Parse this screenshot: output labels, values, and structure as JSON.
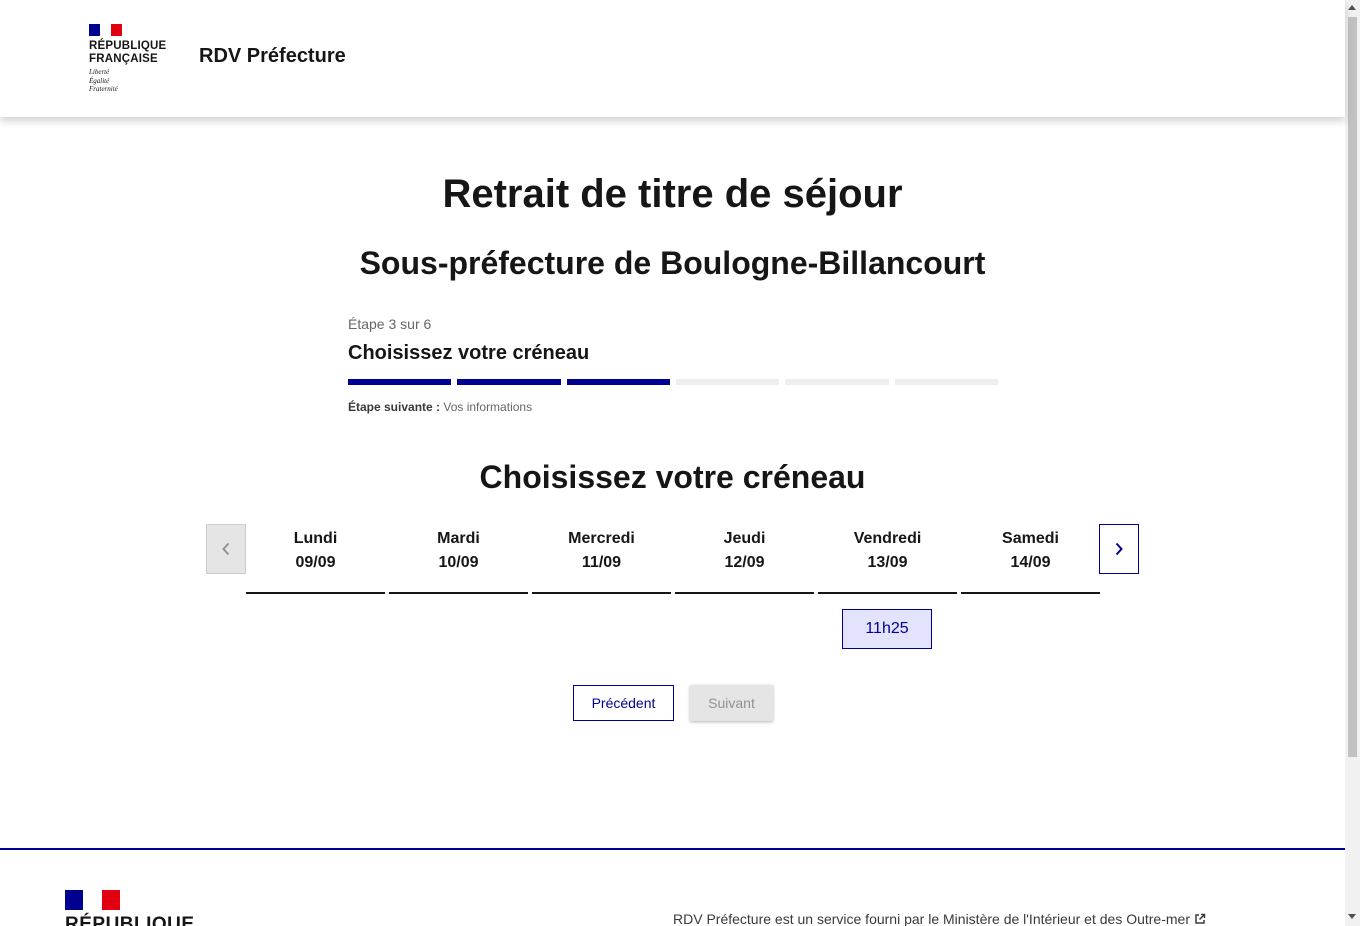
{
  "header": {
    "republique_line1": "RÉPUBLIQUE",
    "republique_line2": "FRANÇAISE",
    "devise_1": "Liberté",
    "devise_2": "Égalité",
    "devise_3": "Fraternité",
    "service_title": "RDV Préfecture"
  },
  "page": {
    "title": "Retrait de titre de séjour",
    "subtitle": "Sous-préfecture de Boulogne-Billancourt"
  },
  "stepper": {
    "state": "Étape 3 sur 6",
    "title": "Choisissez votre créneau",
    "current_step": 3,
    "total_steps": 6,
    "next_label": "Étape suivante :",
    "next_value": " Vos informations"
  },
  "calendar": {
    "title": "Choisissez votre créneau",
    "days": [
      {
        "name": "Lundi",
        "date": "09/09"
      },
      {
        "name": "Mardi",
        "date": "10/09"
      },
      {
        "name": "Mercredi",
        "date": "11/09"
      },
      {
        "name": "Jeudi",
        "date": "12/09"
      },
      {
        "name": "Vendredi",
        "date": "13/09"
      },
      {
        "name": "Samedi",
        "date": "14/09"
      }
    ],
    "slot": "11h25",
    "prev_icon": "chevron-left-icon",
    "next_icon": "chevron-right-icon"
  },
  "buttons": {
    "previous": "Précédent",
    "next": "Suivant"
  },
  "footer": {
    "republique": "RÉPUBLIQUE",
    "text": "RDV Préfecture est un service fourni par le Ministère de l'Intérieur et des Outre-mer",
    "link_icon": "external-link-icon"
  },
  "colors": {
    "primary": "#000091",
    "slot_bg": "#e3e3fd",
    "marianne_red": "#e1000f"
  }
}
